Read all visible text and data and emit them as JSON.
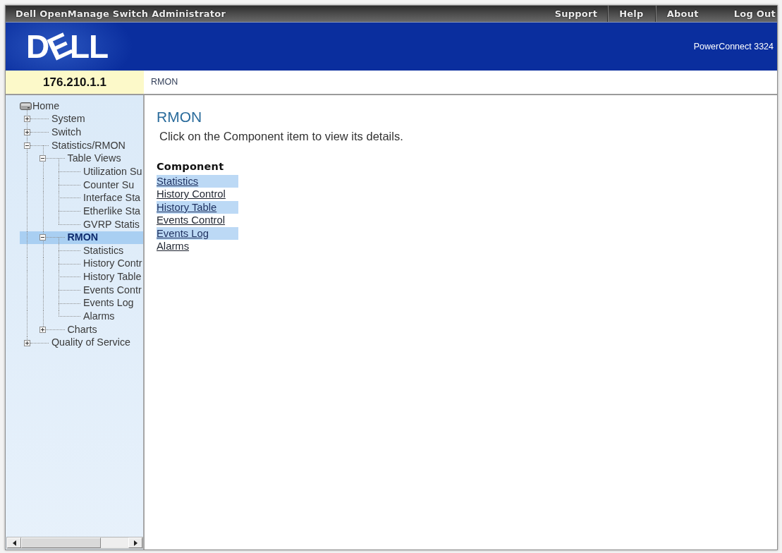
{
  "window": {
    "title": "Dell OpenManage Switch Administrator"
  },
  "header_links": [
    "Support",
    "Help",
    "About",
    "Log Out"
  ],
  "banner": {
    "logo": "DELL",
    "model": "PowerConnect 3324"
  },
  "device": {
    "address": "176.210.1.1"
  },
  "breadcrumb": "RMON",
  "tree": {
    "label": "Home",
    "selected": false,
    "children": [
      {
        "label": "System",
        "expanded": false,
        "selected": false
      },
      {
        "label": "Switch",
        "expanded": false,
        "selected": false
      },
      {
        "label": "Statistics/RMON",
        "expanded": true,
        "selected": false,
        "children": [
          {
            "label": "Table Views",
            "expanded": true,
            "selected": false,
            "children": [
              {
                "label": "Utilization Su",
                "selected": false
              },
              {
                "label": "Counter Su",
                "selected": false
              },
              {
                "label": "Interface Sta",
                "selected": false
              },
              {
                "label": "Etherlike Sta",
                "selected": false
              },
              {
                "label": "GVRP Statis",
                "selected": false
              }
            ]
          },
          {
            "label": "RMON",
            "expanded": true,
            "selected": true,
            "children": [
              {
                "label": "Statistics",
                "selected": false
              },
              {
                "label": "History Contr",
                "selected": false
              },
              {
                "label": "History Table",
                "selected": false
              },
              {
                "label": "Events Contr",
                "selected": false
              },
              {
                "label": "Events Log",
                "selected": false
              },
              {
                "label": "Alarms",
                "selected": false
              }
            ]
          },
          {
            "label": "Charts",
            "expanded": false,
            "selected": false
          }
        ]
      },
      {
        "label": "Quality of Service",
        "expanded": false,
        "selected": false
      }
    ]
  },
  "content": {
    "title": "RMON",
    "description": "Click on the Component item to view its details.",
    "list_heading": "Component",
    "items": [
      "Statistics",
      "History Control",
      "History Table",
      "Events Control",
      "Events Log",
      "Alarms"
    ]
  }
}
